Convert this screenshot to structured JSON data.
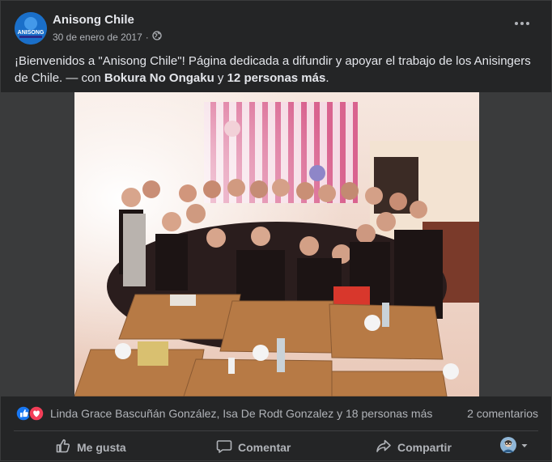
{
  "post": {
    "page_name": "Anisong Chile",
    "avatar_text": "ANISONG",
    "date": "30 de enero de 2017",
    "separator": "·",
    "caption_main": "¡Bienvenidos a \"Anisong Chile\"! Página dedicada a difundir y apoyar el trabajo de los Anisingers de Chile. — con ",
    "caption_tag_1": "Bokura No Ongaku",
    "caption_and": " y ",
    "caption_tag_2": "12 personas más",
    "caption_end": "."
  },
  "reactions": {
    "names": "Linda Grace Bascuñán González, Isa De Rodt Gonzalez y 18 personas más",
    "comments": "2 comentarios",
    "icons": [
      "like-reaction-icon",
      "love-reaction-icon"
    ],
    "like_color": "#1877f2",
    "love_color": "#f33e58"
  },
  "actions": {
    "like": "Me gusta",
    "comment": "Comentar",
    "share": "Compartir"
  },
  "colors": {
    "background": "#242526",
    "text_primary": "#e4e6eb",
    "text_secondary": "#b0b3b8"
  }
}
